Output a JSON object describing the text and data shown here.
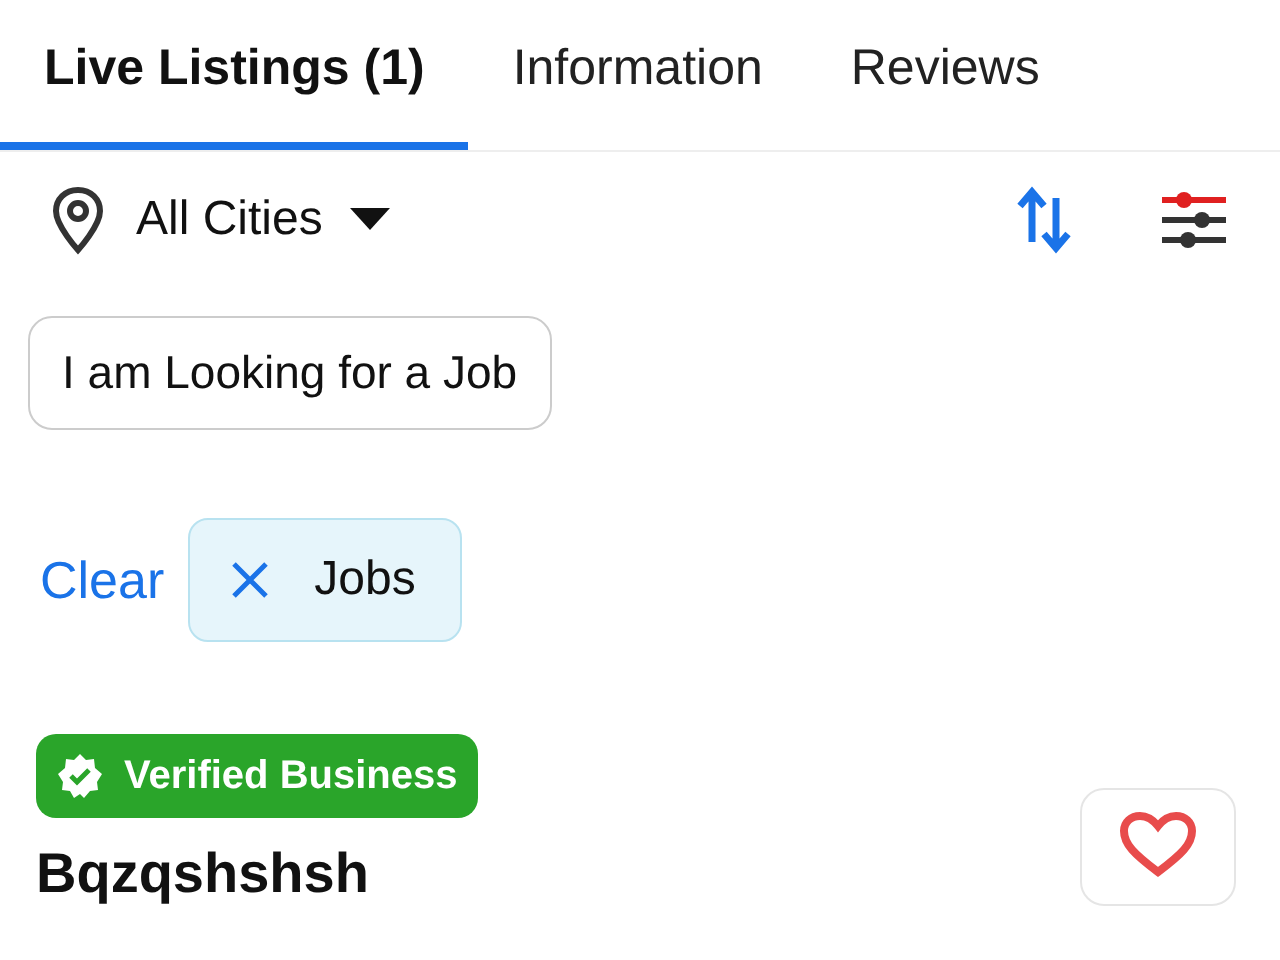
{
  "tabs": [
    {
      "label": "Live Listings (1)",
      "selected": true
    },
    {
      "label": "Information",
      "selected": false
    },
    {
      "label": "Reviews",
      "selected": false
    }
  ],
  "location": {
    "label": "All Cities"
  },
  "quick_filters": [
    {
      "label": "I am Looking for a Job"
    }
  ],
  "clear_label": "Clear",
  "active_filters": [
    {
      "label": "Jobs"
    }
  ],
  "listing": {
    "badge": "Verified Business",
    "title": "Bqzqshshsh",
    "favorite": false
  }
}
